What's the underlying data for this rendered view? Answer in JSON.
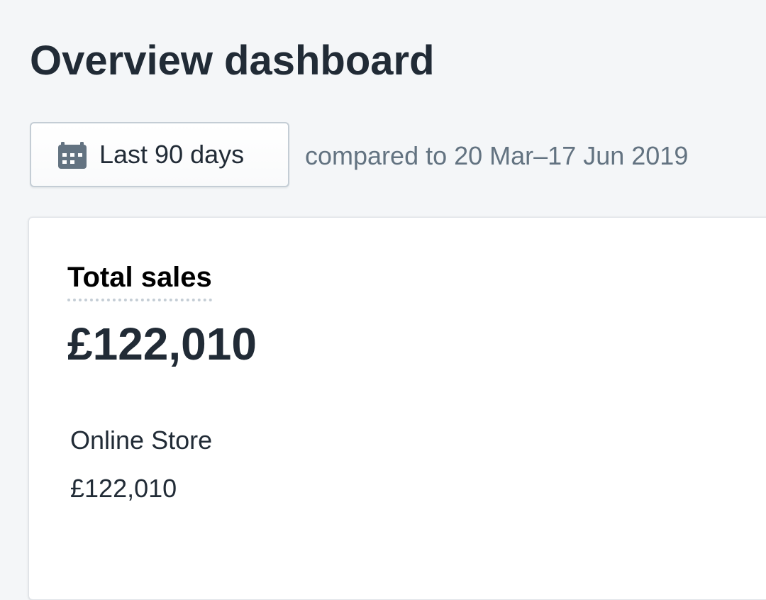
{
  "header": {
    "title": "Overview dashboard"
  },
  "date_range": {
    "button_label": "Last 90 days",
    "icon": "calendar-icon",
    "comparison_text": "compared to 20 Mar–17 Jun 2019"
  },
  "total_sales_card": {
    "title": "Total sales",
    "total": "£122,010",
    "channels": [
      {
        "name": "Online Store",
        "value": "£122,010"
      }
    ]
  },
  "colors": {
    "background": "#f4f6f8",
    "text_primary": "#212b36",
    "text_subdued": "#637381",
    "icon": "#637381",
    "border": "#c4cdd5"
  }
}
